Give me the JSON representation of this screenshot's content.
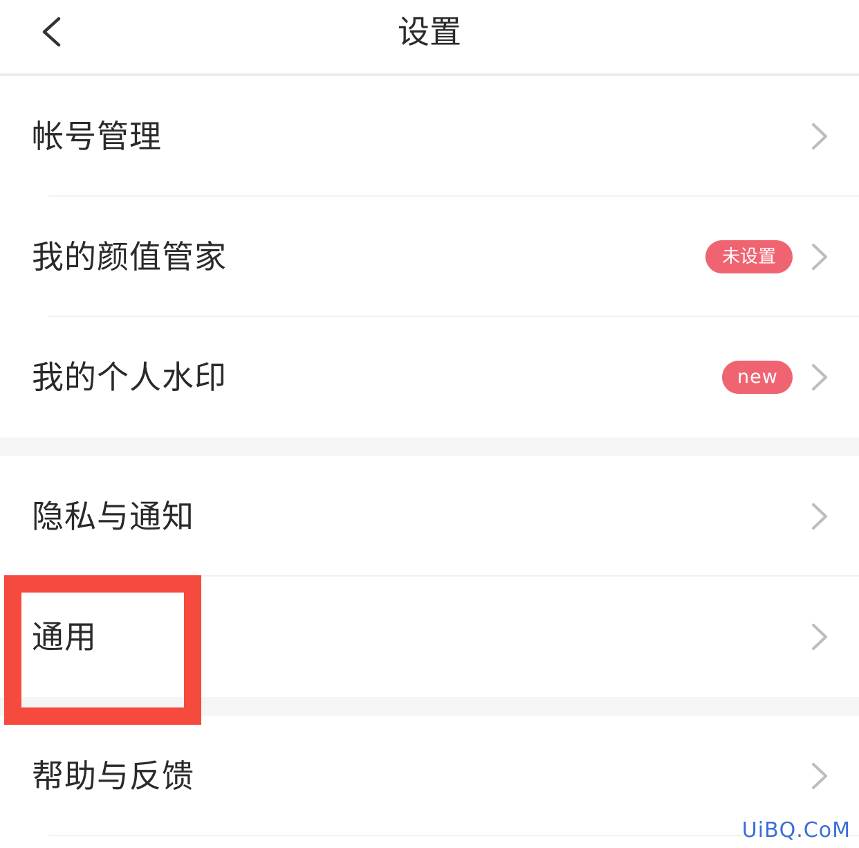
{
  "header": {
    "title": "设置",
    "back_icon": "chevron-left-icon"
  },
  "settings": {
    "group1": [
      {
        "label": "帐号管理",
        "badge": null
      },
      {
        "label": "我的颜值管家",
        "badge": "未设置"
      },
      {
        "label": "我的个人水印",
        "badge": "new"
      }
    ],
    "group2": [
      {
        "label": "隐私与通知",
        "badge": null
      },
      {
        "label": "通用",
        "badge": null,
        "highlighted": true
      }
    ],
    "group3": [
      {
        "label": "帮助与反馈",
        "badge": null
      }
    ]
  },
  "colors": {
    "badge": "#f06472",
    "highlight": "#f64a3e",
    "section_gap": "#f5f5f5",
    "chevron": "#bdbdbd"
  },
  "watermark": "UiBQ.CoM"
}
